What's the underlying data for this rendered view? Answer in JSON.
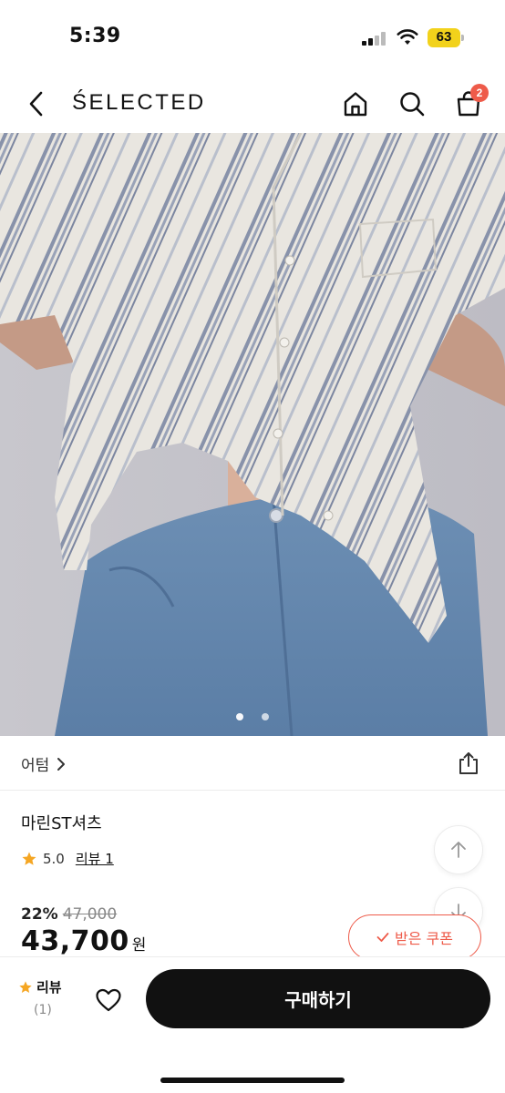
{
  "status_bar": {
    "time": "5:39",
    "battery": "63"
  },
  "header": {
    "brand": "ŚELECTED",
    "cart_count": "2"
  },
  "gallery": {
    "page_count": 2,
    "current_index": 0
  },
  "breadcrumb": {
    "category": "어텀"
  },
  "product": {
    "name": "마린ST셔츠",
    "rating": "5.0",
    "review_link": "리뷰 1",
    "discount_rate": "22%",
    "original_price": "47,000",
    "price": "43,700",
    "currency": "원"
  },
  "coupon": {
    "label": "받은 쿠폰"
  },
  "bottom_bar": {
    "review_label": "리뷰",
    "review_count": "(1)",
    "buy_label": "구매하기"
  },
  "colors": {
    "accent": "#ee5b4a",
    "star": "#f5a623",
    "primary_button": "#111111"
  },
  "icons": [
    "back-icon",
    "home-icon",
    "search-icon",
    "cart-icon",
    "chevron-right-icon",
    "share-icon",
    "star-icon",
    "arrow-up-icon",
    "arrow-down-icon",
    "check-icon",
    "heart-icon"
  ]
}
